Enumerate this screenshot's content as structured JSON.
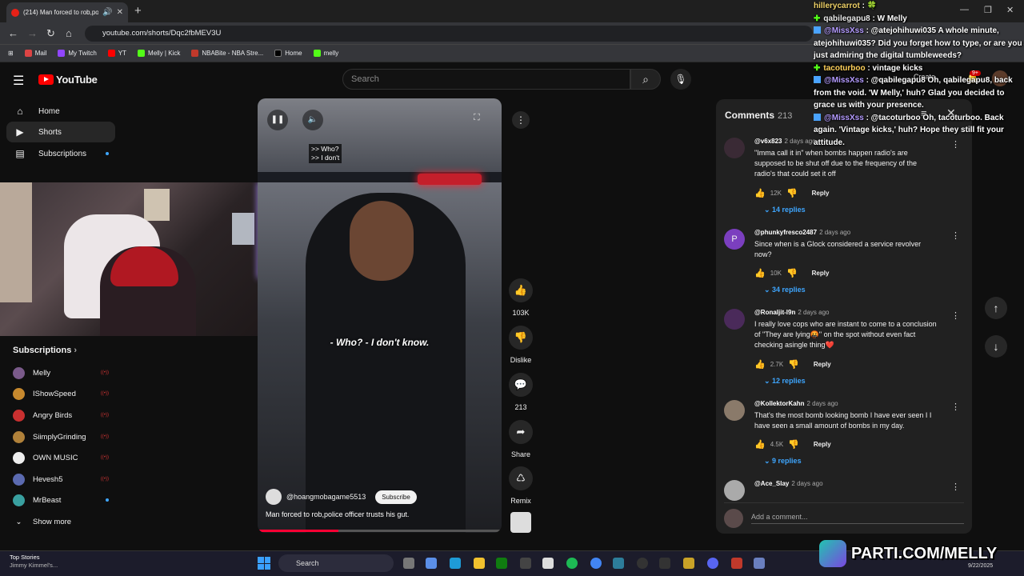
{
  "browser": {
    "tab_title": "(214) Man forced to rob,po",
    "url": "youtube.com/shorts/Dqc2fbMEV3U",
    "bookmarks": [
      "Mail",
      "My Twitch",
      "YT",
      "Melly | Kick",
      "NBABite - NBA Stre...",
      "Home",
      "melly"
    ]
  },
  "youtube": {
    "logo": "YouTube",
    "search_placeholder": "Search",
    "create": "Create",
    "notif_badge": "9+",
    "nav": [
      {
        "label": "Home",
        "icon": "home-icon"
      },
      {
        "label": "Shorts",
        "icon": "shorts-icon"
      },
      {
        "label": "Subscriptions",
        "icon": "subscriptions-icon"
      }
    ],
    "subscriptions_header": "Subscriptions",
    "subscriptions": [
      {
        "name": "Melly",
        "color": "#7a5a8a",
        "live": true
      },
      {
        "name": "IShowSpeed",
        "color": "#c7892e",
        "live": true
      },
      {
        "name": "Angry Birds",
        "color": "#c93030",
        "live": true
      },
      {
        "name": "SiimplyGrinding",
        "color": "#b0813a",
        "live": true
      },
      {
        "name": "OWN MUSIC",
        "color": "#eeeeee",
        "live": true
      },
      {
        "name": "Hevesh5",
        "color": "#5b6ab0",
        "live": true
      },
      {
        "name": "MrBeast",
        "color": "#39a0a0",
        "live": false
      }
    ],
    "show_more": "Show more"
  },
  "short": {
    "caption_top": [
      ">> Who?",
      ">> I don't"
    ],
    "caption_main": "- Who? - I don't know.",
    "channel": "@hoangmobagame5513",
    "subscribe": "Subscribe",
    "title": "Man forced to rob,police officer trusts his gut.",
    "progress": 0.33,
    "actions": [
      {
        "icon": "like-icon",
        "label": "103K"
      },
      {
        "icon": "dislike-icon",
        "label": "Dislike"
      },
      {
        "icon": "comment-icon",
        "label": "213"
      },
      {
        "icon": "share-icon",
        "label": "Share"
      },
      {
        "icon": "remix-icon",
        "label": "Remix"
      }
    ]
  },
  "comments": {
    "title": "Comments",
    "count": "213",
    "items": [
      {
        "user": "@v6x823",
        "ago": "2 days ago",
        "text": "\"Imma call it in\" when bombs happen radio's are supposed to be shut off due to the frequency of the radio's that could set it off",
        "likes": "12K",
        "replies": "14 replies",
        "color": "#3a2a35"
      },
      {
        "user": "@phunkyfresco2487",
        "ago": "2 days ago",
        "text": "Since when is a Glock considered a service revolver now?",
        "likes": "10K",
        "replies": "34 replies",
        "color": "#7b3fbf",
        "initial": "P"
      },
      {
        "user": "@Ronaljit-l9n",
        "ago": "2 days ago",
        "text": "I really love cops who are instant to come to a conclusion of \"They are lying🤬\" on the spot without even fact checking asingle thing❤️",
        "likes": "2.7K",
        "replies": "12 replies",
        "color": "#4a2a5a"
      },
      {
        "user": "@KollektorKahn",
        "ago": "2 days ago",
        "text": "That's the most bomb looking bomb I have ever seen I I have seen a small amount of bombs in my day.",
        "likes": "4.5K",
        "replies": "9 replies",
        "color": "#8a7a6a"
      },
      {
        "user": "@Ace_Slay",
        "ago": "2 days ago",
        "text": "",
        "likes": "",
        "replies": "",
        "color": "#aaaaaa"
      }
    ],
    "reply_label": "Reply",
    "add_placeholder": "Add a comment..."
  },
  "chat": [
    {
      "platform": "none",
      "user": "hillerycarrot",
      "msg": ": 🍀",
      "ucls": "u1"
    },
    {
      "platform": "kick",
      "user": "qabilegapu8",
      "msg": ": W Melly",
      "ucls": "u2"
    },
    {
      "platform": "twitch",
      "user": "@MissXss",
      "msg": ": @atejohihuwi035 A whole minute, atejohihuwi035? Did you forget how to type, or are you just admiring the digital tumbleweeds?",
      "ucls": "u3"
    },
    {
      "platform": "kick",
      "user": "tacoturboo",
      "msg": ": vintage kicks",
      "ucls": "u4"
    },
    {
      "platform": "twitch",
      "user": "@MissXss",
      "msg": ": @qabilegapu8 Oh, qabilegapu8, back from the void. 'W Melly,' huh? Glad you decided to grace us with your presence.",
      "ucls": "u3"
    },
    {
      "platform": "twitch",
      "user": "@MissXss",
      "msg": ": @tacoturboo Oh, tacoturboo. Back again. 'Vintage kicks,' huh? Hope they still fit your attitude.",
      "ucls": "u3"
    }
  ],
  "taskbar": {
    "news_title": "Top Stories",
    "news_sub": "Jimmy Kimmel's...",
    "search": "Search",
    "date": "9/22/2025"
  },
  "banner": "PARTI.COM/MELLY"
}
